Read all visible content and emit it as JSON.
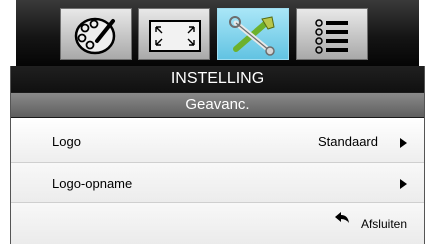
{
  "tabs": [
    {
      "icon": "palette-brush-icon",
      "active": false
    },
    {
      "icon": "screen-resize-icon",
      "active": false
    },
    {
      "icon": "tools-settings-icon",
      "active": true
    },
    {
      "icon": "options-list-icon",
      "active": false
    }
  ],
  "menu": {
    "title": "INSTELLING",
    "subtitle": "Geavanc.",
    "rows": [
      {
        "label": "Logo",
        "value": "Standaard",
        "has_submenu": true
      },
      {
        "label": "Logo-opname",
        "value": "",
        "has_submenu": true
      }
    ],
    "exit_label": "Afsluiten",
    "exit_icon": "return-arrow-icon"
  },
  "colors": {
    "active_tab": "#62c3e2",
    "inactive_tab": "#a9a9a9",
    "panel_dark": "#1a1a1a",
    "subtitle_bar": "#5e5e5e"
  }
}
